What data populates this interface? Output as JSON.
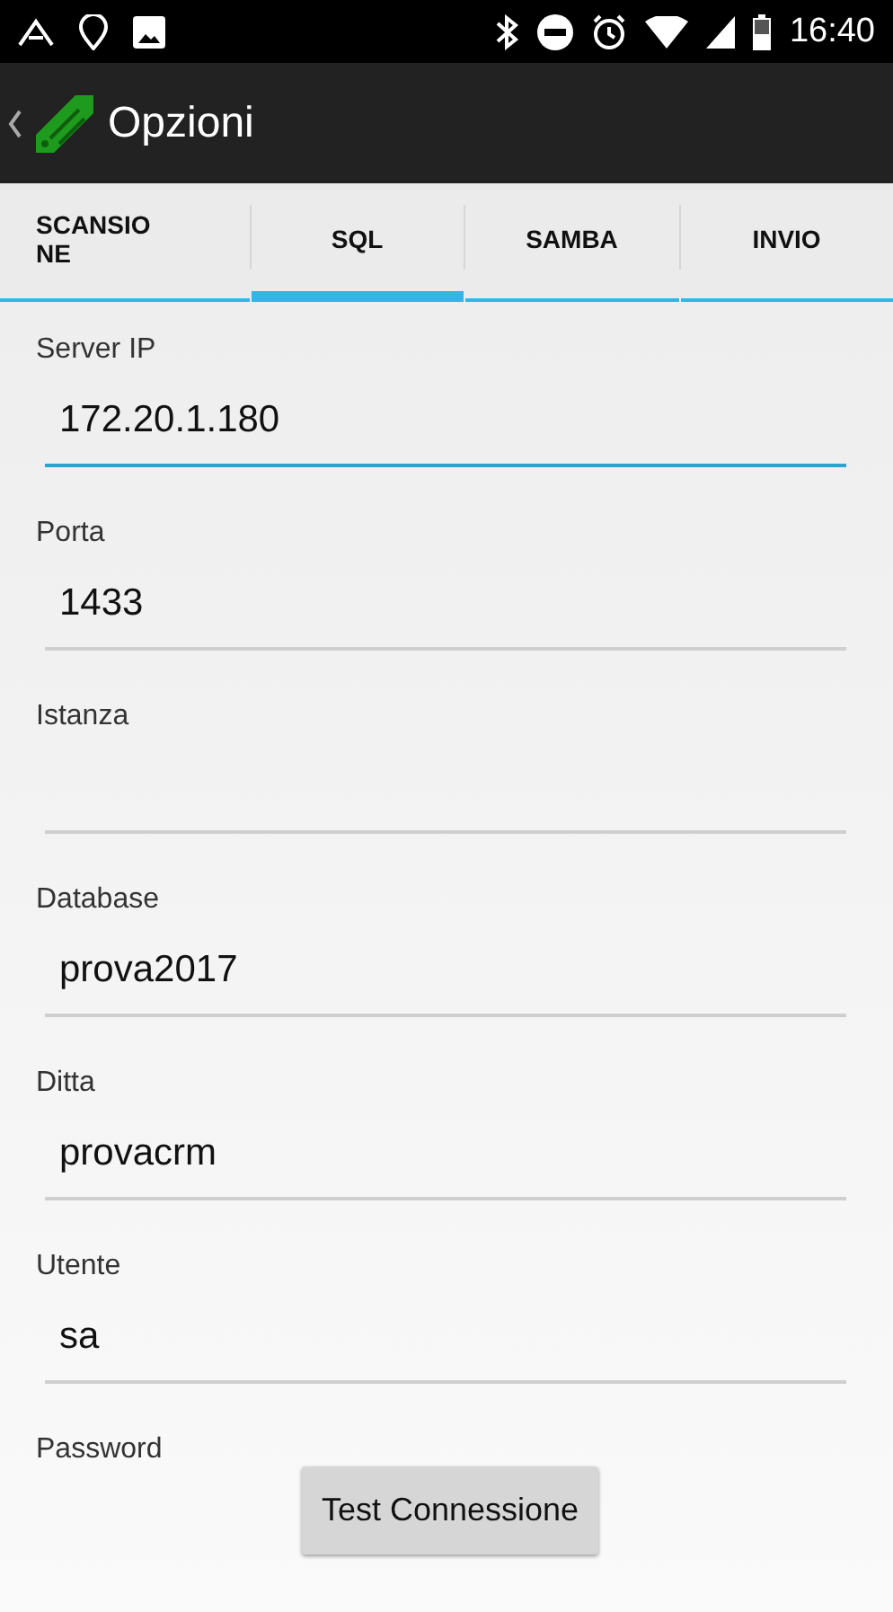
{
  "status_bar": {
    "time": "16:40"
  },
  "app_bar": {
    "title": "Opzioni"
  },
  "tabs": [
    {
      "label": "SCANSIO NE",
      "selected": false
    },
    {
      "label": "SQL",
      "selected": true
    },
    {
      "label": "SAMBA",
      "selected": false
    },
    {
      "label": "INVIO",
      "selected": false
    }
  ],
  "fields": [
    {
      "label": "Server IP",
      "value": "172.20.1.180",
      "focused": true
    },
    {
      "label": "Porta",
      "value": "1433",
      "focused": false
    },
    {
      "label": "Istanza",
      "focused": false
    },
    {
      "label": "Database",
      "value": "prova2017",
      "focused": false
    },
    {
      "label": "Ditta",
      "value": "provacrm",
      "focused": false
    },
    {
      "label": "Utente",
      "value": "sa",
      "focused": false
    }
  ],
  "password_label": "Password",
  "test_button": "Test Connessione"
}
